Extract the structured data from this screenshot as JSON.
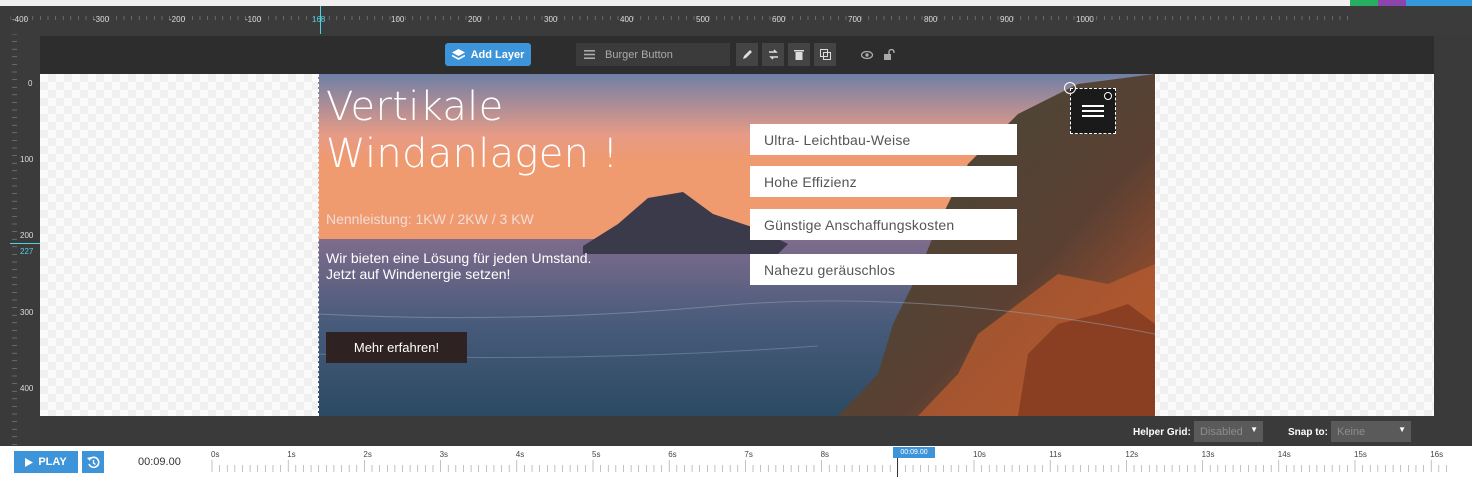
{
  "top_buttons": {
    "save_icon": "save-icon",
    "code_label": "</>",
    "settings_icon": "gear-icon",
    "search_icon": "search-icon"
  },
  "hruler": {
    "labels": [
      "-400",
      "-300",
      "-200",
      "-100",
      "168",
      "100",
      "200",
      "300",
      "400",
      "500",
      "600",
      "700",
      "800",
      "900",
      "1000"
    ],
    "active_label": "168"
  },
  "vruler": {
    "labels": [
      "0",
      "100",
      "200",
      "227",
      "300",
      "400"
    ],
    "active_label": "227"
  },
  "toolbar": {
    "add_layer_label": "Add Layer",
    "layer_name": "Burger Button"
  },
  "slide": {
    "title": "Vertikale\nWindanlagen !",
    "subtitle": "Nennleistung: 1KW / 2KW / 3 KW",
    "description": "Wir bieten eine Lösung für jeden Umstand.\nJetzt auf Windenergie setzen!",
    "cta_label": "Mehr erfahren!",
    "features": [
      "Ultra- Leichtbau-Weise",
      "Hohe Effizienz",
      "Günstige Anschaffungskosten",
      "Nahezu geräuschlos"
    ]
  },
  "bottombar": {
    "helper_grid_label": "Helper Grid:",
    "helper_grid_value": "Disabled",
    "snap_to_label": "Snap to:",
    "snap_to_value": "Keine"
  },
  "timeline": {
    "play_label": "PLAY",
    "time": "00:09.00",
    "marker_time": "00:09.00",
    "ticks": [
      "0s",
      "1s",
      "2s",
      "3s",
      "4s",
      "5s",
      "6s",
      "7s",
      "8s",
      "9s",
      "10s",
      "11s",
      "12s",
      "13s",
      "14s",
      "15s",
      "16s"
    ]
  },
  "colors": {
    "accent": "#3d94d8",
    "save": "#27ae60",
    "code": "#8e44ad",
    "ruler_active": "#4fd3e3"
  }
}
